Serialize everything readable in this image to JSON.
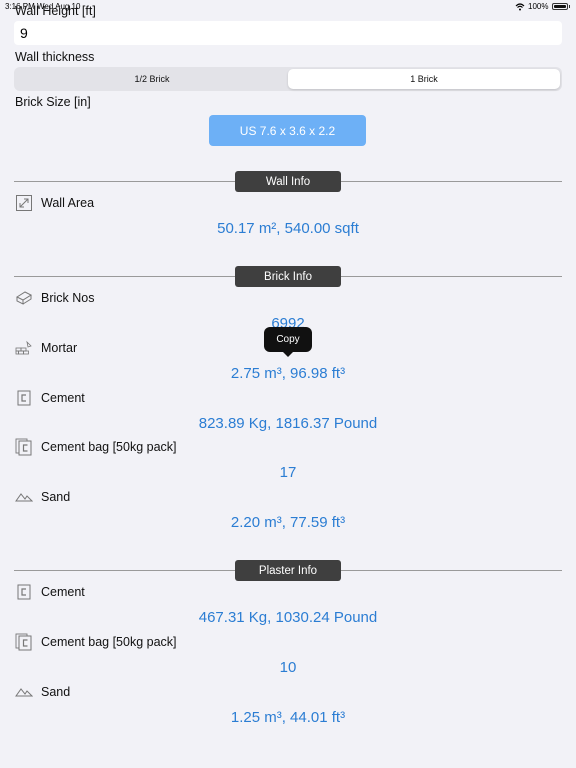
{
  "status_bar": {
    "time": "3:16 PM   Wed Aug 10",
    "battery": "100%"
  },
  "form": {
    "wall_height_label": "Wall Height [ft]",
    "wall_height_value": "9",
    "wall_thickness_label": "Wall thickness",
    "thickness_options": [
      "1/2 Brick",
      "1 Brick"
    ],
    "thickness_selected": "1 Brick",
    "brick_size_label": "Brick Size [in]",
    "brick_size_value": "US 7.6 x 3.6 x 2.2"
  },
  "wall_info": {
    "header": "Wall Info",
    "area_label": "Wall Area",
    "area_value": "50.17 m², 540.00 sqft"
  },
  "brick_info": {
    "header": "Brick Info",
    "brick_nos_label": "Brick Nos",
    "brick_nos_value": "6992",
    "mortar_label": "Mortar",
    "mortar_value": "2.75 m³, 96.98 ft³",
    "cement_label": "Cement",
    "cement_value": "823.89 Kg, 1816.37 Pound",
    "cement_bag_label": "Cement bag [50kg pack]",
    "cement_bag_value": "17",
    "sand_label": "Sand",
    "sand_value": "2.20 m³, 77.59 ft³"
  },
  "plaster_info": {
    "header": "Plaster Info",
    "cement_label": "Cement",
    "cement_value": "467.31 Kg, 1030.24 Pound",
    "cement_bag_label": "Cement bag [50kg pack]",
    "cement_bag_value": "10",
    "sand_label": "Sand",
    "sand_value": "1.25 m³, 44.01 ft³"
  },
  "tooltip": {
    "label": "Copy"
  },
  "icons": {
    "wall_area": "resize-arrows-icon",
    "brick": "brick-icon",
    "mortar": "brick-wall-trowel-icon",
    "cement": "cement-bag-icon",
    "cement_bag": "stacked-bags-icon",
    "sand": "sand-pile-icon"
  },
  "colors": {
    "accent": "#2b7dd3",
    "button": "#6db0f6",
    "header_pill": "#3f3f3f"
  }
}
